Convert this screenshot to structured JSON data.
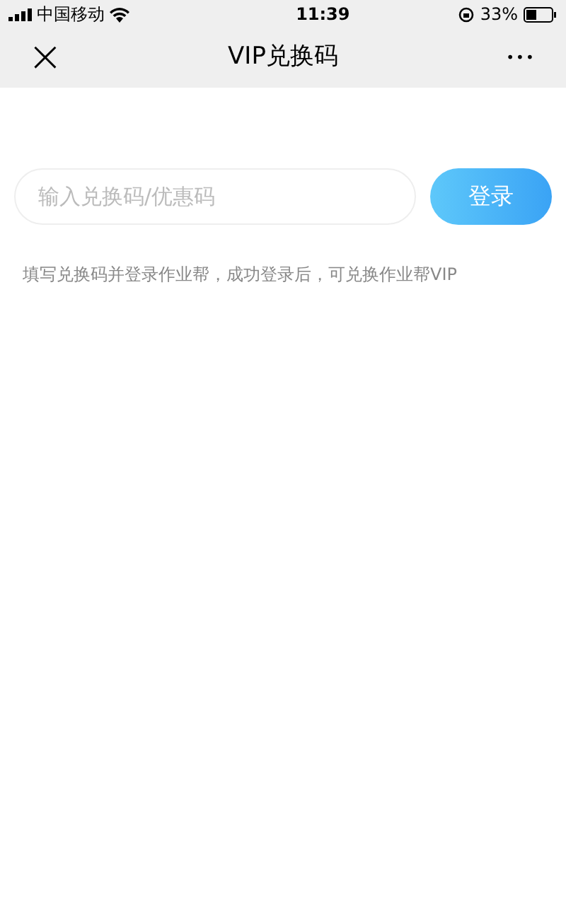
{
  "status_bar": {
    "carrier": "中国移动",
    "time": "11:39",
    "battery": "33%"
  },
  "nav_bar": {
    "close_icon": "×",
    "title": "VIP兑换码",
    "more_icon": "•••"
  },
  "redeem_form": {
    "placeholder": "输入兑换码/优惠码",
    "button": "登录",
    "hint": "填写兑换码并登录作业帮，成功登录后，可兑换作业帮VIP"
  }
}
